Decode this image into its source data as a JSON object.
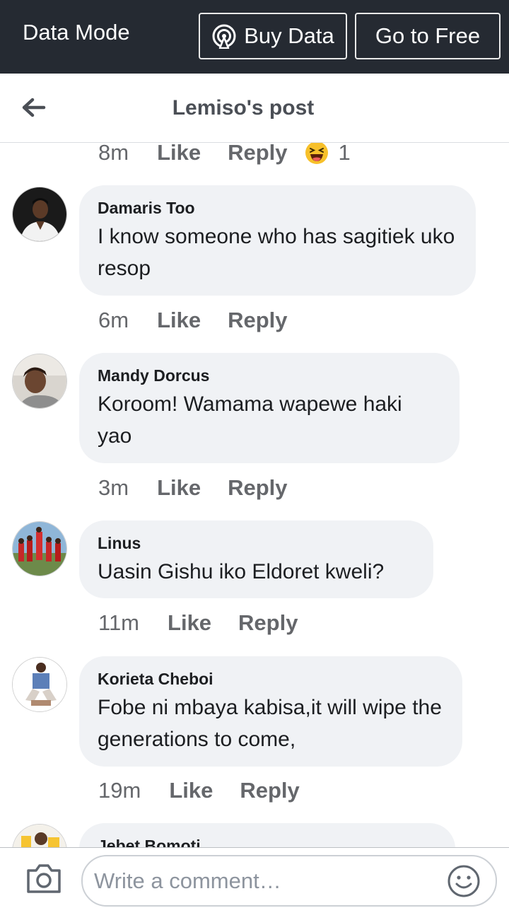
{
  "databar": {
    "mode_label": "Data Mode",
    "buy_label": "Buy Data",
    "free_label": "Go to Free",
    "bg_color": "#252a32"
  },
  "header": {
    "title": "Lemiso's post",
    "back_icon": "arrow-left-icon"
  },
  "prev_comment_actions": {
    "time": "8m",
    "like": "Like",
    "reply": "Reply",
    "reaction_icon": "haha-emoji-icon",
    "reaction_count": "1"
  },
  "comments": [
    {
      "author": "Damaris Too",
      "text": "I know someone who has sagitiek uko resop",
      "time": "6m",
      "like": "Like",
      "reply": "Reply"
    },
    {
      "author": "Mandy Dorcus",
      "text": "Koroom! Wamama wapewe haki yao",
      "time": "3m",
      "like": "Like",
      "reply": "Reply"
    },
    {
      "author": "Linus",
      "text": "Uasin Gishu iko Eldoret kweli?",
      "time": "11m",
      "like": "Like",
      "reply": "Reply"
    },
    {
      "author": "Korieta Cheboi",
      "text": "Fobe ni mbaya kabisa,it will wipe the generations to come,",
      "time": "19m",
      "like": "Like",
      "reply": "Reply"
    },
    {
      "author": "Jebet Bomoti",
      "text": ""
    }
  ],
  "composer": {
    "placeholder": "Write a comment…",
    "camera_icon": "camera-icon",
    "emoji_icon": "smiley-icon"
  }
}
